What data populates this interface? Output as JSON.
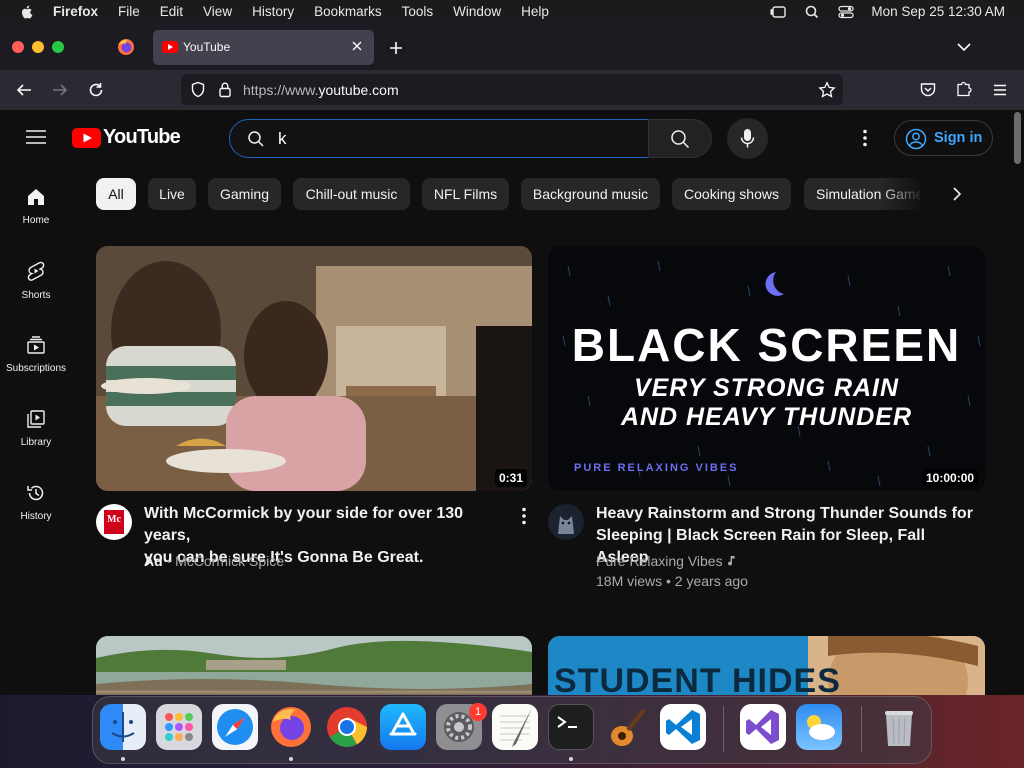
{
  "menubar": {
    "app_name": "Firefox",
    "menus": [
      "File",
      "Edit",
      "View",
      "History",
      "Bookmarks",
      "Tools",
      "Window",
      "Help"
    ],
    "clock": "Mon Sep 25  12:30 AM"
  },
  "browser": {
    "tab_title": "YouTube",
    "url_prefix": "https://www.",
    "url_host": "youtube.com"
  },
  "youtube": {
    "logo_text": "YouTube",
    "search_value": "k",
    "sign_in_label": "Sign in",
    "chips": [
      "All",
      "Live",
      "Gaming",
      "Chill-out music",
      "NFL Films",
      "Background music",
      "Cooking shows",
      "Simulation Games"
    ],
    "sidebar": [
      {
        "label": "Home"
      },
      {
        "label": "Shorts"
      },
      {
        "label": "Subscriptions"
      },
      {
        "label": "Library"
      },
      {
        "label": "History"
      }
    ],
    "videos": [
      {
        "title_line1": "With McCormick by your side for over 130 years,",
        "title_line2": "you can be sure It's Gonna Be Great.",
        "ad_badge": "Ad",
        "channel": "McCormick Spice",
        "duration": "0:31",
        "avatar_text": "Mc"
      },
      {
        "title_line1": "Heavy Rainstorm and Strong Thunder Sounds for",
        "title_line2": "Sleeping | Black Screen Rain for Sleep, Fall Asleep",
        "channel": "Pure Relaxing Vibes",
        "stats": "18M views • 2 years ago",
        "duration": "10:00:00",
        "thumb_headline": "BLACK SCREEN",
        "thumb_line1": "VERY STRONG RAIN",
        "thumb_line2": "AND HEAVY THUNDER",
        "thumb_brand": "PURE RELAXING VIBES"
      },
      {
        "title_line1": ""
      },
      {
        "thumb_headline": "STUDENT HIDES"
      }
    ]
  },
  "dock": {
    "settings_badge": "1",
    "apps": [
      "Finder",
      "Launchpad",
      "Safari",
      "Firefox",
      "Chrome",
      "App Store",
      "System Settings",
      "TextEdit",
      "Terminal",
      "GarageBand",
      "VS Code",
      "Visual Studio",
      "Weather",
      "Trash"
    ]
  },
  "colors": {
    "yt_bg": "#0f0f0f",
    "yt_red": "#ff0000",
    "link_blue": "#3ea6ff",
    "chip_bg": "#272727"
  }
}
